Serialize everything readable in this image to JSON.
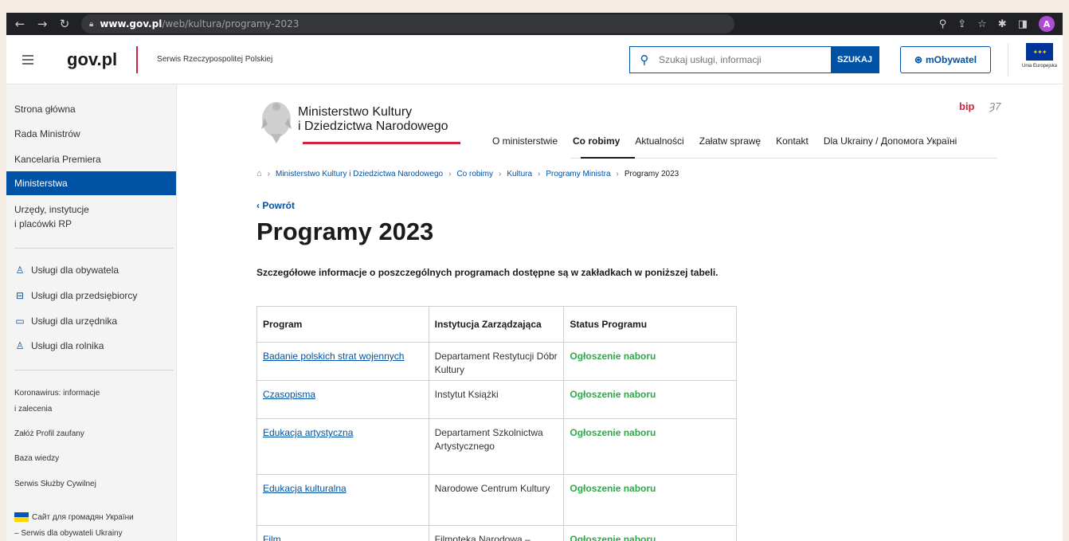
{
  "browser": {
    "url_host": "www.gov.pl",
    "url_path": "/web/kultura/programy-2023",
    "profile_initial": "A"
  },
  "header": {
    "logo": "gov.pl",
    "subtitle": "Serwis Rzeczypospolitej Polskiej",
    "search_placeholder": "Szukaj usługi, informacji",
    "search_button": "SZUKAJ",
    "mobywatel": "mObywatel",
    "eu_label": "Unia Europejska"
  },
  "sidebar": {
    "main_items": [
      "Strona główna",
      "Rada Ministrów",
      "Kancelaria Premiera",
      "Ministerstwa",
      "Urzędy, instytucje",
      "i placówki RP"
    ],
    "services": [
      "Usługi dla obywatela",
      "Usługi dla przedsiębiorcy",
      "Usługi dla urzędnika",
      "Usługi dla rolnika"
    ],
    "links": [
      "Koronawirus: informacje",
      "i zalecenia",
      "Załóż Profil zaufany",
      "Baza wiedzy",
      "Serwis Służby Cywilnej"
    ],
    "ukraine_line1": "Сайт для громадян України",
    "ukraine_line2": "– Serwis dla obywateli Ukrainy"
  },
  "ministry": {
    "name_line1": "Ministerstwo Kultury",
    "name_line2": "i Dziedzictwa Narodowego",
    "bip": "bip",
    "sign": "Ȝ7"
  },
  "topnav": [
    "O ministerstwie",
    "Co robimy",
    "Aktualności",
    "Załatw sprawę",
    "Kontakt",
    "Dla Ukrainy / Допомога Україні"
  ],
  "breadcrumb": [
    "Ministerstwo Kultury i Dziedzictwa Narodowego",
    "Co robimy",
    "Kultura",
    "Programy Ministra",
    "Programy 2023"
  ],
  "back_label": "Powrót",
  "page_title": "Programy 2023",
  "intro": "Szczegółowe informacje o poszczególnych programach dostępne są w zakładkach w poniższej tabeli.",
  "table": {
    "headers": [
      "Program",
      "Instytucja  Zarządzająca",
      "Status Programu"
    ],
    "rows": [
      {
        "program": "Badanie polskich strat wojennych",
        "institution": "Departament Restytucji Dóbr Kultury",
        "status": "Ogłoszenie naboru"
      },
      {
        "program": "Czasopisma",
        "institution": "Instytut Książki",
        "status": "Ogłoszenie naboru"
      },
      {
        "program": "Edukacja artystyczna",
        "institution": "Departament Szkolnictwa Artystycznego",
        "status": "Ogłoszenie naboru"
      },
      {
        "program": "Edukacja kulturalna",
        "institution": "Narodowe Centrum Kultury",
        "status": "Ogłoszenie naboru"
      },
      {
        "program": "Film",
        "institution": "Filmoteka Narodowa –",
        "status": "Ogłoszenie naboru"
      }
    ]
  }
}
